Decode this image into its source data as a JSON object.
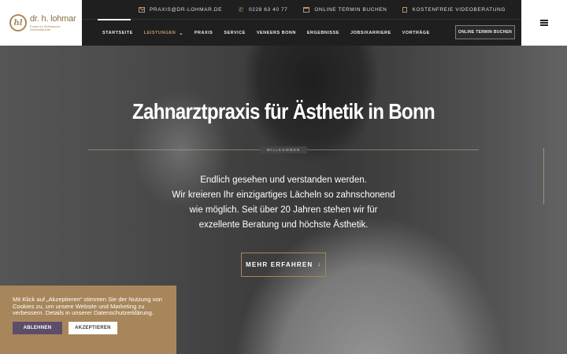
{
  "logo": {
    "mark": "hl",
    "name": "dr. h. lohmar",
    "tagline": "Praxis für Ästhetische Zahnheilkunde"
  },
  "topbar": {
    "items": [
      {
        "icon": "mail-icon",
        "label": "PRAXIS@DR-LOHMAR.DE"
      },
      {
        "icon": "phone-icon",
        "label": "0228 63 40 77"
      },
      {
        "icon": "calendar-icon",
        "label": "ONLINE TERMIN BUCHEN"
      },
      {
        "icon": "video-icon",
        "label": "KOSTENFREIE VIDEOBERATUNG"
      }
    ]
  },
  "nav": {
    "items": [
      {
        "label": "STARTSEITE"
      },
      {
        "label": "LEISTUNGEN"
      },
      {
        "label": "PRAXIS"
      },
      {
        "label": "SERVICE"
      },
      {
        "label": "VENEERS BONN"
      },
      {
        "label": "ERGEBNISSE"
      },
      {
        "label": "JOBS/KARRIERE"
      },
      {
        "label": "VORTRÄGE"
      }
    ],
    "cta": "ONLINE TERMIN BUCHEN"
  },
  "hero": {
    "title": "Zahnarztpraxis für Ästhetik in Bonn",
    "eyebrow": "WILLKOMMEN",
    "lines": [
      "Endlich gesehen und verstanden werden.",
      "Wir kreieren Ihr einzigartiges Lächeln so zahnschonend",
      "wie möglich. Seit über 20 Jahren stehen wir für",
      "exzellente Beratung und höchste Ästhetik."
    ],
    "button": "MEHR ERFAHREN",
    "button_arrow": "↓"
  },
  "cookie": {
    "text": "Mit Klick auf „Akzeptieren“ stimmen Sie der Nutzung von Cookies zu, um unsere Website und Marketing zu verbessern. Details in unserer Datenschutzerklärung.",
    "decline": "ABLEHNEN",
    "accept": "AKZEPTIEREN"
  },
  "colors": {
    "accent": "#a8865b",
    "header": "#1f1f1f",
    "decline_button": "#5c4e6a"
  }
}
